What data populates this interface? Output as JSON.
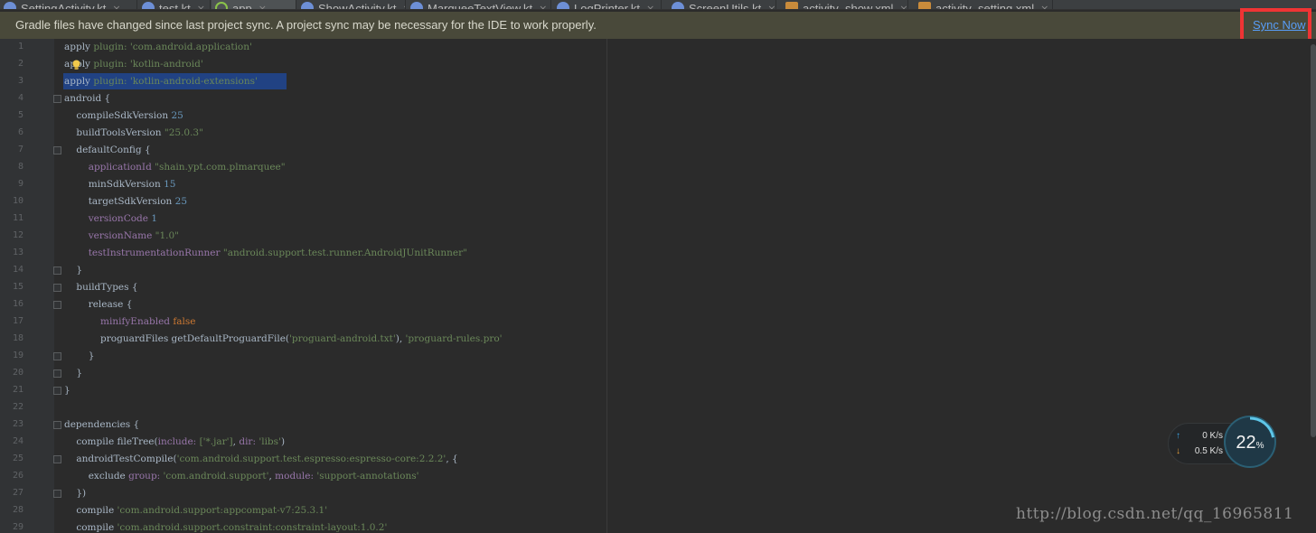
{
  "tabs": [
    {
      "label": "SettingActivity.kt",
      "icon": "kotlin-file-icon"
    },
    {
      "label": "test.kt",
      "icon": "kotlin-file-icon"
    },
    {
      "label": "app",
      "icon": "gradle-file-icon",
      "active": true
    },
    {
      "label": "ShowActivity.kt",
      "icon": "kotlin-file-icon"
    },
    {
      "label": "MarqueeTextView.kt",
      "icon": "kotlin-file-icon"
    },
    {
      "label": "LogPrinter.kt",
      "icon": "kotlin-file-icon"
    },
    {
      "label": "ScreenUtils.kt",
      "icon": "kotlin-file-icon"
    },
    {
      "label": "activity_show.xml",
      "icon": "xml-file-icon"
    },
    {
      "label": "activity_setting.xml",
      "icon": "xml-file-icon"
    }
  ],
  "banner": {
    "message": "Gradle files have changed since last project sync. A project sync may be necessary for the IDE to work properly.",
    "sync_label": "Sync Now"
  },
  "editor": {
    "line_numbers": [
      "1",
      "2",
      "3",
      "4",
      "5",
      "6",
      "7",
      "8",
      "9",
      "10",
      "11",
      "12",
      "13",
      "14",
      "15",
      "16",
      "17",
      "18",
      "19",
      "20",
      "21",
      "22",
      "23",
      "24",
      "25",
      "26",
      "27",
      "28",
      "29"
    ],
    "lines": [
      [
        [
          "apply ",
          "plain"
        ],
        [
          "plugin: ",
          "str"
        ],
        [
          "'com.android.application'",
          "str"
        ]
      ],
      [
        [
          "apply ",
          "plain"
        ],
        [
          "plugin: ",
          "str"
        ],
        [
          "'kotlin-android'",
          "str"
        ]
      ],
      [
        [
          "apply ",
          "plain"
        ],
        [
          "plugin: ",
          "str"
        ],
        [
          "'kotlin-android-extensions'",
          "str"
        ]
      ],
      [
        [
          "android {",
          "plain"
        ]
      ],
      [
        [
          "    compileSdkVersion ",
          "plain"
        ],
        [
          "25",
          "num"
        ]
      ],
      [
        [
          "    buildToolsVersion ",
          "plain"
        ],
        [
          "\"25.0.3\"",
          "str"
        ]
      ],
      [
        [
          "    defaultConfig {",
          "plain"
        ]
      ],
      [
        [
          "        applicationId ",
          "prop"
        ],
        [
          "\"shain.ypt.com.plmarquee\"",
          "str"
        ]
      ],
      [
        [
          "        minSdkVersion ",
          "plain"
        ],
        [
          "15",
          "num"
        ]
      ],
      [
        [
          "        targetSdkVersion ",
          "plain"
        ],
        [
          "25",
          "num"
        ]
      ],
      [
        [
          "        versionCode ",
          "prop"
        ],
        [
          "1",
          "num"
        ]
      ],
      [
        [
          "        versionName ",
          "prop"
        ],
        [
          "\"1.0\"",
          "str"
        ]
      ],
      [
        [
          "        testInstrumentationRunner ",
          "prop"
        ],
        [
          "\"android.support.test.runner.AndroidJUnitRunner\"",
          "str"
        ]
      ],
      [
        [
          "    }",
          "plain"
        ]
      ],
      [
        [
          "    buildTypes {",
          "plain"
        ]
      ],
      [
        [
          "        release {",
          "plain"
        ]
      ],
      [
        [
          "            minifyEnabled ",
          "prop"
        ],
        [
          "false",
          "kw"
        ]
      ],
      [
        [
          "            proguardFiles getDefaultProguardFile(",
          "plain"
        ],
        [
          "'proguard-android.txt'",
          "str"
        ],
        [
          "), ",
          "plain"
        ],
        [
          "'proguard-rules.pro'",
          "str"
        ]
      ],
      [
        [
          "        }",
          "plain"
        ]
      ],
      [
        [
          "    }",
          "plain"
        ]
      ],
      [
        [
          "}",
          "plain"
        ]
      ],
      [
        [
          "",
          "plain"
        ]
      ],
      [
        [
          "dependencies {",
          "plain"
        ]
      ],
      [
        [
          "    compile fileTree(",
          "plain"
        ],
        [
          "include: ",
          "prop"
        ],
        [
          "['*.jar']",
          "str"
        ],
        [
          ", ",
          "plain"
        ],
        [
          "dir: ",
          "prop"
        ],
        [
          "'libs'",
          "str"
        ],
        [
          ")",
          "plain"
        ]
      ],
      [
        [
          "    androidTestCompile(",
          "plain"
        ],
        [
          "'com.android.support.test.espresso:espresso-core:2.2.2'",
          "str"
        ],
        [
          ", {",
          "plain"
        ]
      ],
      [
        [
          "        exclude ",
          "plain"
        ],
        [
          "group: ",
          "prop"
        ],
        [
          "'com.android.support'",
          "str"
        ],
        [
          ", ",
          "plain"
        ],
        [
          "module: ",
          "prop"
        ],
        [
          "'support-annotations'",
          "str"
        ]
      ],
      [
        [
          "    })",
          "plain"
        ]
      ],
      [
        [
          "    compile ",
          "plain"
        ],
        [
          "'com.android.support:appcompat-v7:25.3.1'",
          "str"
        ]
      ],
      [
        [
          "    compile ",
          "plain"
        ],
        [
          "'com.android.support.constraint:constraint-layout:1.0.2'",
          "str"
        ]
      ]
    ]
  },
  "network_widget": {
    "upload_speed": "0",
    "upload_unit": "K/s",
    "download_speed": "0.5",
    "download_unit": "K/s",
    "usage_value": "22",
    "usage_unit": "%",
    "usage_fraction": 0.22
  },
  "watermark": "http://blog.csdn.net/qq_16965811",
  "colors": {
    "editor_bg": "#2b2b2b",
    "banner_bg": "#49493a",
    "link": "#589df6",
    "highlight_box": "#ef3434",
    "selection": "#214283"
  }
}
